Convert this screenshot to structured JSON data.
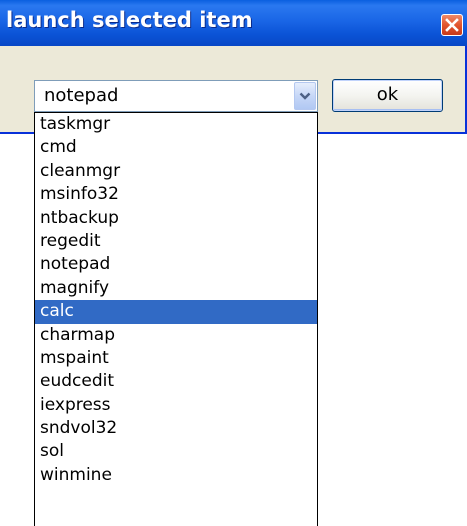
{
  "window": {
    "title": "launch selected item"
  },
  "combo": {
    "value": "notepad"
  },
  "ok_button": {
    "label": "ok"
  },
  "dropdown": {
    "selected_index": 8,
    "items": [
      {
        "label": "taskmgr"
      },
      {
        "label": "cmd"
      },
      {
        "label": "cleanmgr"
      },
      {
        "label": "msinfo32"
      },
      {
        "label": "ntbackup"
      },
      {
        "label": "regedit"
      },
      {
        "label": "notepad"
      },
      {
        "label": "magnify"
      },
      {
        "label": "calc"
      },
      {
        "label": "charmap"
      },
      {
        "label": "mspaint"
      },
      {
        "label": "eudcedit"
      },
      {
        "label": "iexpress"
      },
      {
        "label": "sndvol32"
      },
      {
        "label": "sol"
      },
      {
        "label": "winmine"
      }
    ]
  },
  "colors": {
    "titlebar": "#0b53d6",
    "dialog_bg": "#ece9d8",
    "selection": "#316ac5",
    "close_button": "#e2552e"
  },
  "icons": {
    "close": "close-icon",
    "dropdown_arrow": "chevron-down-icon"
  }
}
